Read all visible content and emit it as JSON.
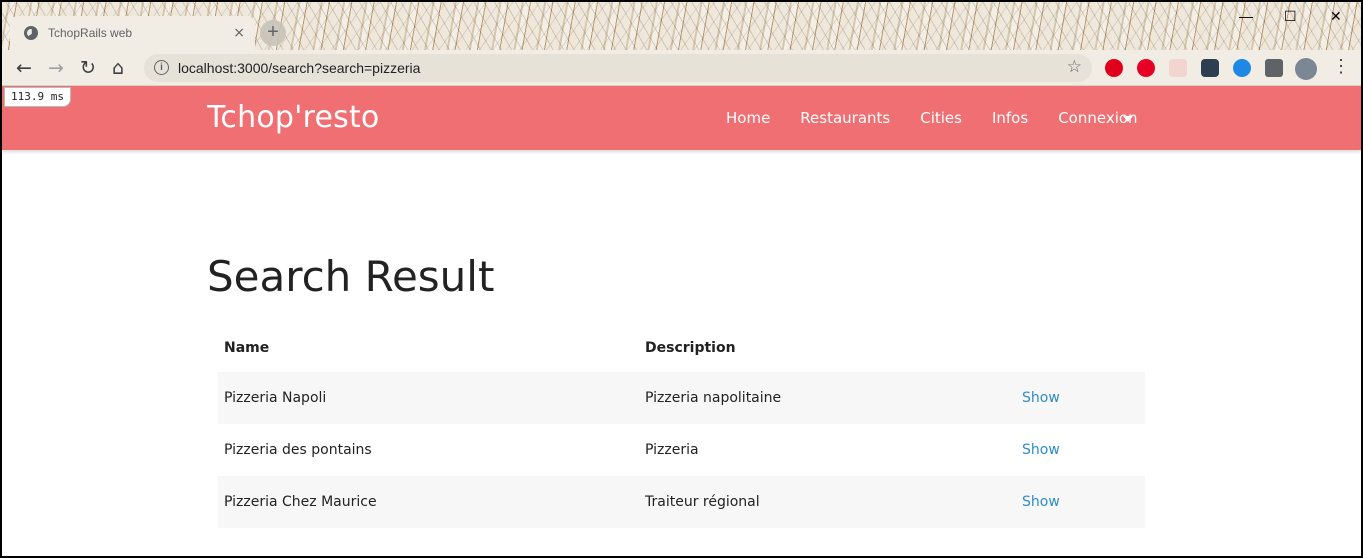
{
  "browser": {
    "tab_title": "TchopRails web",
    "tab_close": "×",
    "new_tab": "+",
    "url": "localhost:3000/search?search=pizzeria",
    "window_controls": {
      "minimize": "—",
      "maximize": "☐",
      "close": "✕"
    }
  },
  "profiler": {
    "timing": "113.9 ms"
  },
  "navbar": {
    "brand": "Tchop'resto",
    "links": [
      "Home",
      "Restaurants",
      "Cities",
      "Infos",
      "Connexion"
    ]
  },
  "page": {
    "title": "Search Result",
    "table": {
      "headers": [
        "Name",
        "Description",
        ""
      ],
      "rows": [
        {
          "name": "Pizzeria Napoli",
          "description": "Pizzeria napolitaine",
          "action": "Show"
        },
        {
          "name": "Pizzeria des pontains",
          "description": "Pizzeria",
          "action": "Show"
        },
        {
          "name": "Pizzeria Chez Maurice",
          "description": "Traiteur régional",
          "action": "Show"
        }
      ]
    }
  },
  "colors": {
    "navbar": "#ef6f73",
    "link": "#2e8bc9"
  }
}
